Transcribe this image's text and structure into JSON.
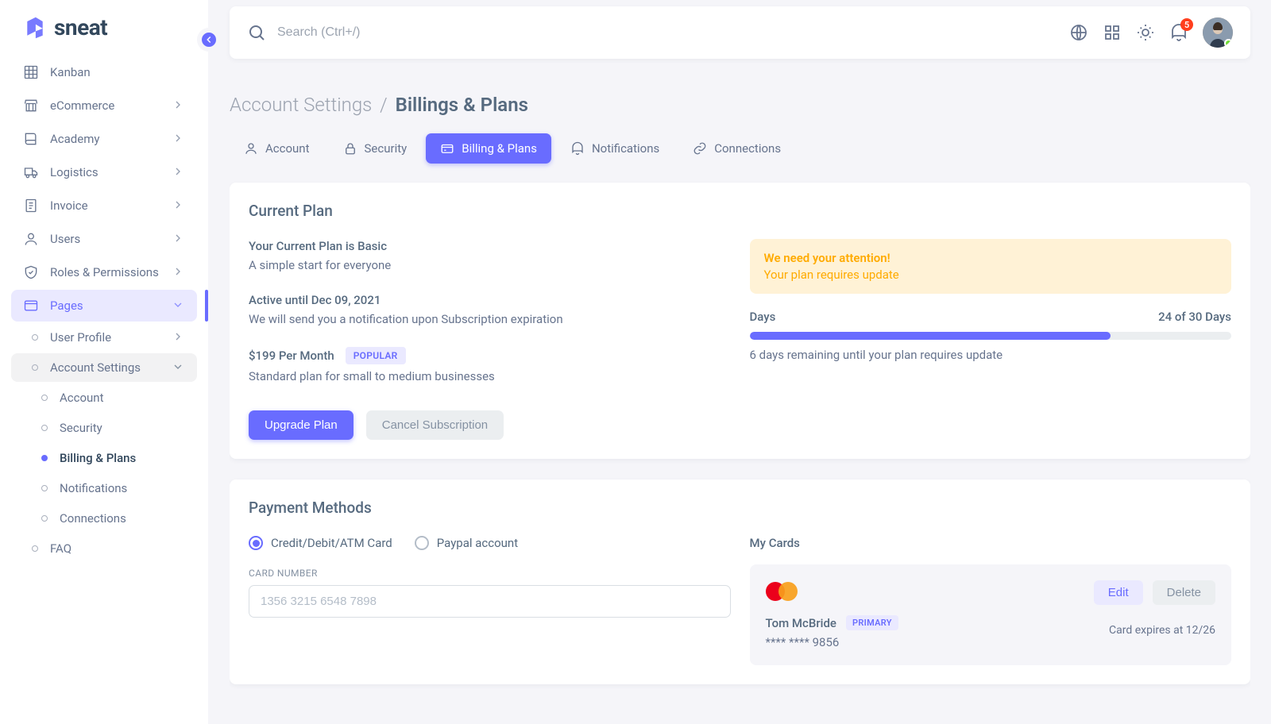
{
  "brand": {
    "name": "sneat"
  },
  "search": {
    "placeholder": "Search (Ctrl+/)"
  },
  "notifications_count": "5",
  "sidebar": {
    "items": [
      {
        "label": "Kanban",
        "icon": "grid",
        "chev": false
      },
      {
        "label": "eCommerce",
        "icon": "store",
        "chev": true
      },
      {
        "label": "Academy",
        "icon": "book",
        "chev": true
      },
      {
        "label": "Logistics",
        "icon": "truck",
        "chev": true
      },
      {
        "label": "Invoice",
        "icon": "file",
        "chev": true
      },
      {
        "label": "Users",
        "icon": "user",
        "chev": true
      },
      {
        "label": "Roles & Permissions",
        "icon": "shield",
        "chev": true
      },
      {
        "label": "Pages",
        "icon": "window",
        "chev": true,
        "state": "active"
      }
    ],
    "sub1": [
      {
        "label": "User Profile",
        "chev": true
      },
      {
        "label": "Account Settings",
        "chev": true,
        "state": "open"
      }
    ],
    "sub2": [
      {
        "label": "Account"
      },
      {
        "label": "Security"
      },
      {
        "label": "Billing & Plans",
        "current": true
      },
      {
        "label": "Notifications"
      },
      {
        "label": "Connections"
      }
    ],
    "sub3": [
      {
        "label": "FAQ"
      }
    ]
  },
  "breadcrumb": {
    "parent": "Account Settings",
    "sep": "/",
    "current": "Billings & Plans"
  },
  "tabs": [
    {
      "label": "Account",
      "icon": "user"
    },
    {
      "label": "Security",
      "icon": "lock"
    },
    {
      "label": "Billing & Plans",
      "icon": "card",
      "active": true
    },
    {
      "label": "Notifications",
      "icon": "bell"
    },
    {
      "label": "Connections",
      "icon": "link"
    }
  ],
  "plan": {
    "title": "Current Plan",
    "h1": "Your Current Plan is Basic",
    "s1": "A simple start for everyone",
    "h2": "Active until Dec 09, 2021",
    "s2": "We will send you a notification upon Subscription expiration",
    "h3": "$199 Per Month",
    "badge": "POPULAR",
    "s3": "Standard plan for small to medium businesses",
    "alert_title": "We need your attention!",
    "alert_msg": "Your plan requires update",
    "days_label": "Days",
    "days_count": "24 of 30 Days",
    "progress_pct": 75,
    "remaining": "6 days remaining until your plan requires update",
    "upgrade": "Upgrade Plan",
    "cancel": "Cancel Subscription"
  },
  "pay": {
    "title": "Payment Methods",
    "radio1": "Credit/Debit/ATM Card",
    "radio2": "Paypal account",
    "card_number_label": "CARD NUMBER",
    "card_number_placeholder": "1356 3215 6548 7898",
    "mycards": "My Cards",
    "owner": "Tom McBride",
    "primary": "PRIMARY",
    "masked": "**** **** 9856",
    "expires": "Card expires at 12/26",
    "edit": "Edit",
    "delete": "Delete"
  }
}
